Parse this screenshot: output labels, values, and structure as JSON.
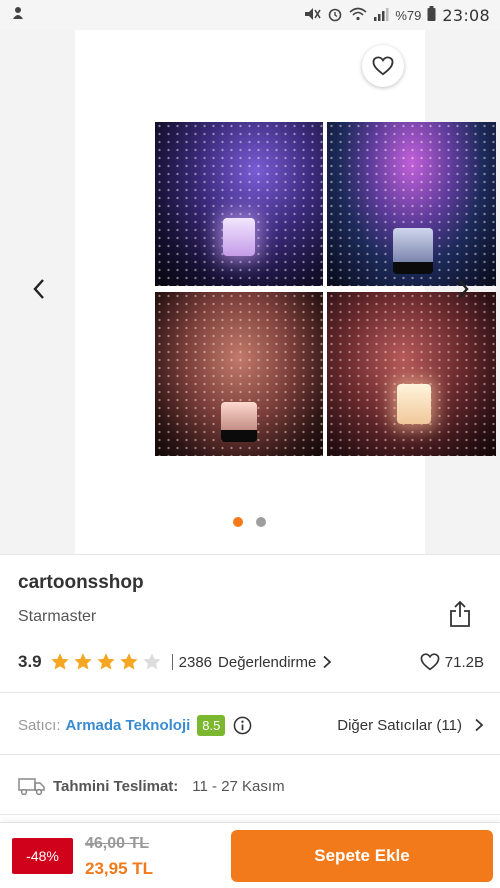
{
  "status_bar": {
    "left_icon": "notification-icon",
    "battery_text": "%79",
    "time": "23:08",
    "icons": [
      "mute-icon",
      "alarm-icon",
      "wifi-icon",
      "signal-icon",
      "battery-icon"
    ]
  },
  "gallery": {
    "photos": [
      "star-projector-purple",
      "star-projector-blue",
      "star-projector-pink",
      "star-projector-red"
    ],
    "page_index": 1,
    "page_count": 2
  },
  "product": {
    "seller_name": "cartoonsshop",
    "product_name": "Starmaster",
    "rating": "3.9",
    "rating_value": 3.9,
    "stars_filled": 4,
    "stars_total": 5,
    "review_count": "2386",
    "review_label": "Değerlendirme",
    "favorite_count": "71.2B"
  },
  "seller": {
    "label": "Satıcı:",
    "name": "Armada Teknoloji",
    "score": "8.5",
    "other_sellers": "Diğer Satıcılar (11)"
  },
  "delivery": {
    "label": "Tahmini Teslimat:",
    "value": "11 - 27 Kasım"
  },
  "price": {
    "discount": "-48%",
    "old": "46,00 TL",
    "new": "23,95 TL"
  },
  "cart": {
    "button_label": "Sepete Ekle"
  },
  "colors": {
    "accent": "#f27a1a",
    "discount": "#d0021b",
    "seller_link": "#3a8bd1",
    "score_badge": "#7cb82f",
    "star_filled": "#f5a623",
    "star_empty": "#dddddd"
  }
}
